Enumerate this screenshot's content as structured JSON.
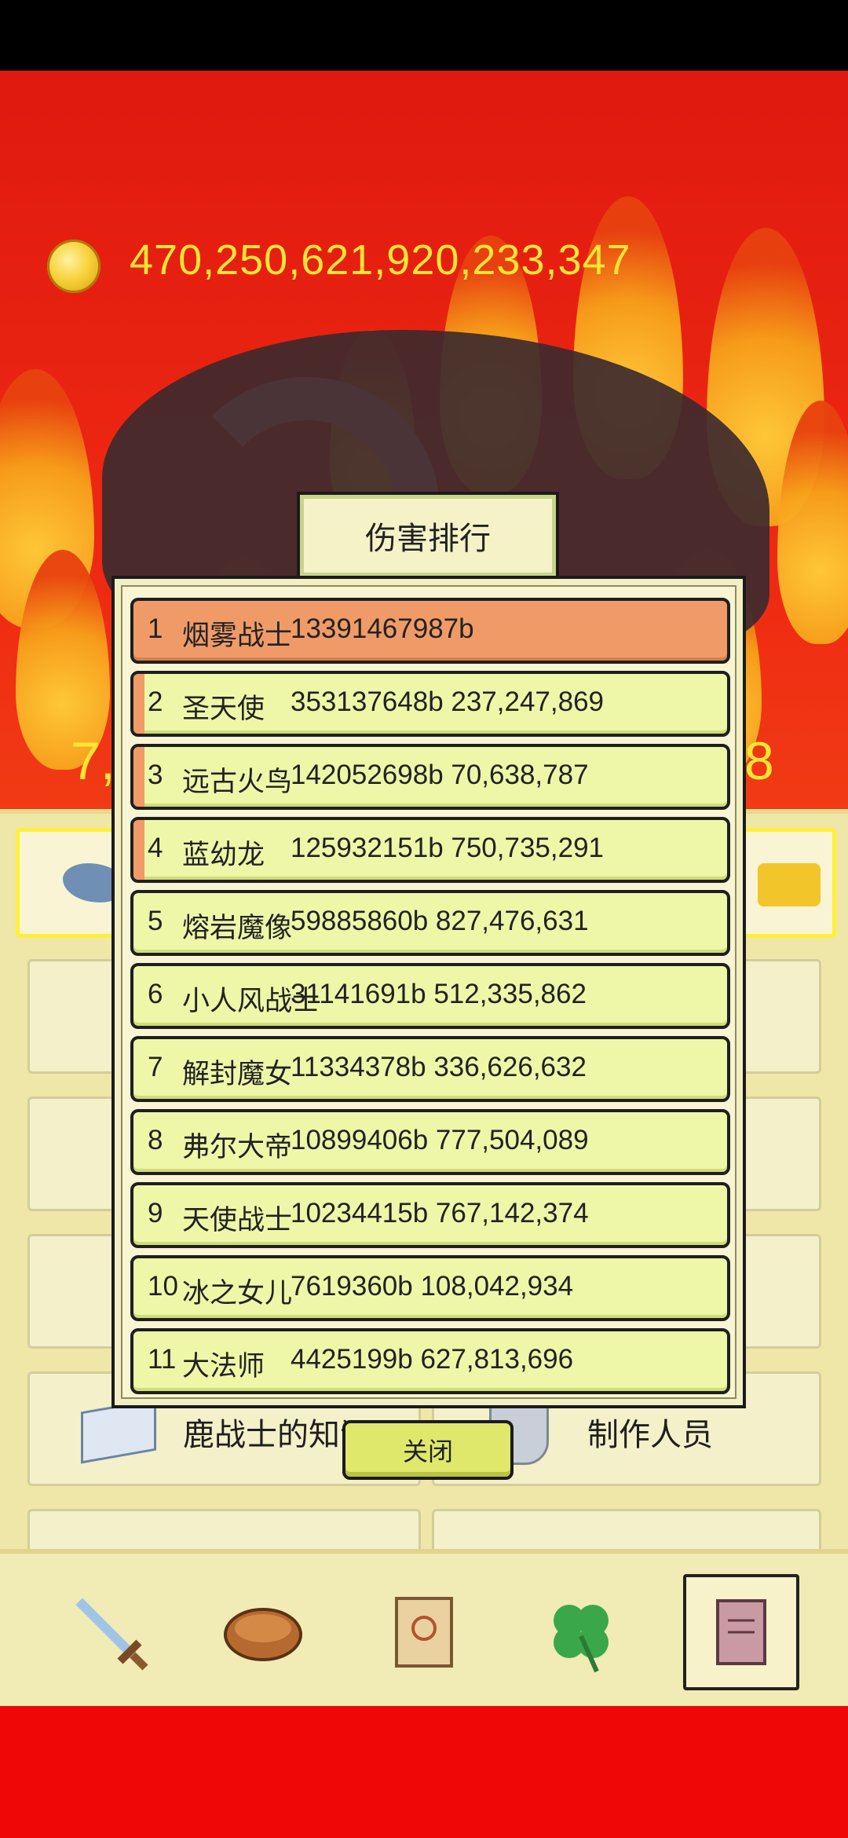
{
  "gold": {
    "amount": "470,250,621,920,233,347"
  },
  "background_numbers": {
    "left": "7,",
    "right": "8"
  },
  "menu": {
    "deer_knowledge": "鹿战士的知识",
    "credits": "制作人员"
  },
  "leaderboard": {
    "title": "伤害排行",
    "rows": [
      {
        "rank": "1",
        "name": "烟雾战士",
        "score": "13391467987b"
      },
      {
        "rank": "2",
        "name": "圣天使",
        "score": "353137648b 237,247,869"
      },
      {
        "rank": "3",
        "name": "远古火鸟",
        "score": "142052698b 70,638,787"
      },
      {
        "rank": "4",
        "name": "蓝幼龙",
        "score": "125932151b 750,735,291"
      },
      {
        "rank": "5",
        "name": "熔岩魔像",
        "score": "59885860b 827,476,631"
      },
      {
        "rank": "6",
        "name": "小人风战士",
        "score": "31141691b 512,335,862"
      },
      {
        "rank": "7",
        "name": "解封魔女",
        "score": "11334378b 336,626,632"
      },
      {
        "rank": "8",
        "name": "弗尔大帝",
        "score": "10899406b 777,504,089"
      },
      {
        "rank": "9",
        "name": "天使战士",
        "score": "10234415b 767,142,374"
      },
      {
        "rank": "10",
        "name": "冰之女儿",
        "score": "7619360b 108,042,934"
      },
      {
        "rank": "11",
        "name": "大法师",
        "score": "4425199b 627,813,696"
      }
    ],
    "close_label": "关闭"
  },
  "nav": {
    "items": [
      "sword-icon",
      "bread-icon",
      "scroll-icon",
      "clover-icon",
      "book-icon"
    ],
    "active_index": 4
  },
  "colors": {
    "gold_text": "#ffe635",
    "top_row": "#f09b67",
    "row": "#eef7a7",
    "bg_red": "#e0190f"
  }
}
